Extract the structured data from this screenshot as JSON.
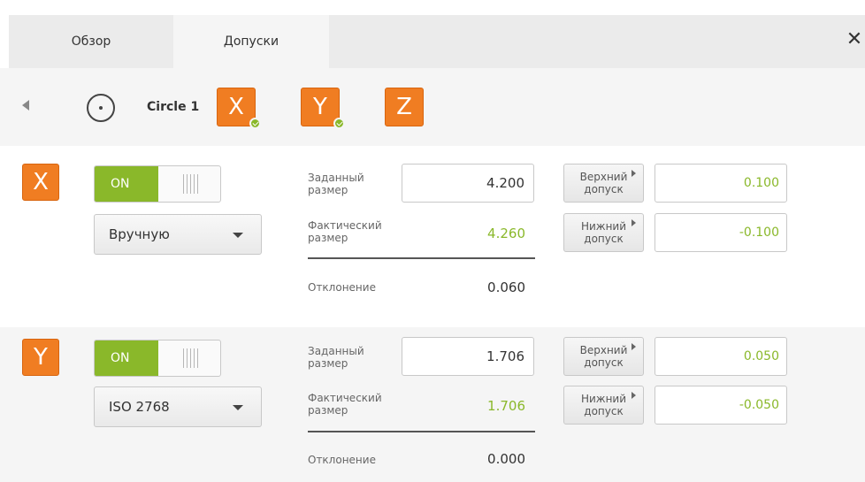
{
  "tabs": [
    {
      "label": "Обзор"
    },
    {
      "label": "Допуски"
    }
  ],
  "close_icon": "close-icon",
  "feature": {
    "name": "Circle 1",
    "icon": "circle-icon",
    "axes": [
      {
        "label": "X",
        "checked": true
      },
      {
        "label": "Y",
        "checked": true
      },
      {
        "label": "Z",
        "checked": false
      }
    ]
  },
  "colors": {
    "accent_orange": "#f07d22",
    "ok_green": "#8ab82a",
    "panel_bg": "#f5f5f5"
  },
  "labels": {
    "nominal_1": "Заданный",
    "nominal_2": "размер",
    "actual_1": "Фактический",
    "actual_2": "размер",
    "deviation": "Отклонение",
    "upper_1": "Верхний",
    "upper_2": "допуск",
    "lower_1": "Нижний",
    "lower_2": "допуск"
  },
  "panels": [
    {
      "axis": "X",
      "toggle": "ON",
      "mode": "Вручную",
      "nominal": "4.200",
      "actual": "4.260",
      "deviation": "0.060",
      "upper_tol": "0.100",
      "lower_tol": "-0.100"
    },
    {
      "axis": "Y",
      "toggle": "ON",
      "mode": "ISO 2768",
      "nominal": "1.706",
      "actual": "1.706",
      "deviation": "0.000",
      "upper_tol": "0.050",
      "lower_tol": "-0.050"
    }
  ]
}
